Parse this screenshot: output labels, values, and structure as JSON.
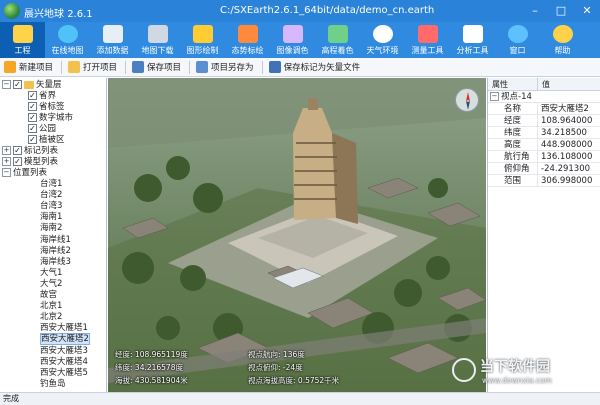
{
  "app": {
    "name": "晨兴地球",
    "version": "2.6.1",
    "path": "C:/SXEarth2.6.1_64bit/data/demo_cn.earth",
    "window_controls": [
      "–",
      "□",
      "✕"
    ]
  },
  "ribbon": [
    {
      "label": "工程",
      "icon": "project-icon",
      "active": true
    },
    {
      "label": "在线地图",
      "icon": "globe-icon"
    },
    {
      "label": "添加数据",
      "icon": "add-data-icon"
    },
    {
      "label": "地图下载",
      "icon": "map-download-icon"
    },
    {
      "label": "图形绘制",
      "icon": "draw-icon"
    },
    {
      "label": "态势标绘",
      "icon": "situation-icon"
    },
    {
      "label": "图像调色",
      "icon": "color-adjust-icon"
    },
    {
      "label": "高程着色",
      "icon": "elevation-color-icon"
    },
    {
      "label": "天气环境",
      "icon": "weather-icon"
    },
    {
      "label": "测量工具",
      "icon": "measure-icon"
    },
    {
      "label": "分析工具",
      "icon": "analysis-icon"
    },
    {
      "label": "窗口",
      "icon": "window-icon"
    },
    {
      "label": "帮助",
      "icon": "help-icon"
    }
  ],
  "toolbar": {
    "new_project": "新建项目",
    "open_project": "打开项目",
    "save_project": "保存项目",
    "save_as": "项目另存为",
    "save_marks_as_vector": "保存标记为矢量文件"
  },
  "tree": {
    "vector_layers": "矢量层",
    "vector_children": [
      "省界",
      "省标签",
      "数字城市",
      "公园",
      "植被区"
    ],
    "mark_list": "标记列表",
    "model_list": "模型列表",
    "position_list": "位置列表",
    "positions": [
      "台湾1",
      "台湾2",
      "台湾3",
      "海南1",
      "海南2",
      "海岸线1",
      "海岸线2",
      "海岸线3",
      "大气1",
      "大气2",
      "故宫",
      "北京1",
      "北京2",
      "西安大雁塔1",
      "西安大雁塔2",
      "西安大雁塔3",
      "西安大雁塔4",
      "西安大雁塔5",
      "钓鱼岛"
    ],
    "selected_position": "西安大雁塔2"
  },
  "map_overlay": {
    "lon_label": "经度:",
    "lon_value": "108.965119度",
    "lat_label": "纬度:",
    "lat_value": "34.216578度",
    "alt_label": "海拔:",
    "alt_value": "430.581904米",
    "heading_label": "视点航向:",
    "heading_value": "136度",
    "pitch_label": "视点俯仰:",
    "pitch_value": "-24度",
    "eye_alt_label": "视点海拔高度:",
    "eye_alt_value": "0.5752千米"
  },
  "properties": {
    "col_name": "属性",
    "col_value": "值",
    "group": "视点-14",
    "rows": [
      {
        "name": "名称",
        "value": "西安大雁塔2"
      },
      {
        "name": "经度",
        "value": "108.964000"
      },
      {
        "name": "纬度",
        "value": "34.218500"
      },
      {
        "name": "高度",
        "value": "448.908000"
      },
      {
        "name": "航行角",
        "value": "136.108000"
      },
      {
        "name": "俯仰角",
        "value": "-24.291300"
      },
      {
        "name": "范围",
        "value": "306.998000"
      }
    ]
  },
  "status": {
    "text": "完成"
  },
  "watermark": {
    "name": "当下软件园",
    "url": "www.downxia.com"
  },
  "colors": {
    "titlebar": "#2b82d9",
    "ribbon": "#2f8ae0",
    "ribbon_active": "#0d5fb3"
  }
}
